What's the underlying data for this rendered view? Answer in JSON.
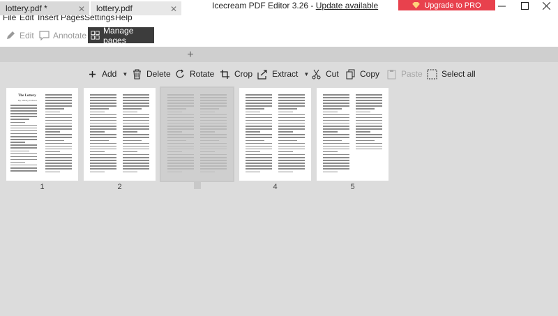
{
  "window": {
    "title": "Icecream PDF Editor 3.26",
    "separator": " - ",
    "update_link": "Update available",
    "pro_button": "Upgrade to PRO"
  },
  "menu": [
    "File",
    "Edit",
    "Insert",
    "Pages",
    "Settings",
    "Help"
  ],
  "modes": {
    "edit": "Edit",
    "annotate": "Annotate",
    "manage": "Manage pages",
    "active": "manage"
  },
  "tabs": [
    {
      "label": "lottery.pdf *",
      "active": false
    },
    {
      "label": "lottery.pdf",
      "active": true
    }
  ],
  "toolbar": {
    "add": "Add",
    "delete": "Delete",
    "rotate": "Rotate",
    "crop": "Crop",
    "extract": "Extract",
    "cut": "Cut",
    "copy": "Copy",
    "paste": "Paste",
    "select_all": "Select all"
  },
  "pages": [
    {
      "number": "1",
      "selected": false
    },
    {
      "number": "2",
      "selected": false
    },
    {
      "number": "3",
      "selected": true
    },
    {
      "number": "4",
      "selected": false
    },
    {
      "number": "5",
      "selected": false
    }
  ],
  "page1_heading": "The Lottery",
  "page1_byline": "By Shirley Jackson",
  "colors": {
    "pro": "#e8414d",
    "active_mode": "#3c3c3c",
    "workspace": "#dcdcdc"
  }
}
